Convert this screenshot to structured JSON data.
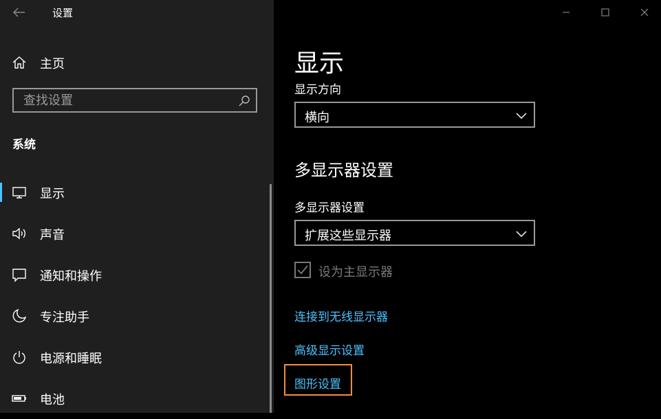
{
  "window": {
    "title": "设置",
    "controls": [
      "minimize",
      "maximize",
      "close"
    ]
  },
  "sidebar": {
    "home_label": "主页",
    "search": {
      "placeholder": "查找设置",
      "value": ""
    },
    "section_label": "系统",
    "items": [
      {
        "label": "显示",
        "icon": "monitor-icon",
        "active": true
      },
      {
        "label": "声音",
        "icon": "speaker-icon",
        "active": false
      },
      {
        "label": "通知和操作",
        "icon": "notification-icon",
        "active": false
      },
      {
        "label": "专注助手",
        "icon": "moon-icon",
        "active": false
      },
      {
        "label": "电源和睡眠",
        "icon": "power-icon",
        "active": false
      },
      {
        "label": "电池",
        "icon": "battery-icon",
        "active": false
      }
    ]
  },
  "main": {
    "title": "显示",
    "orientation": {
      "label": "显示方向",
      "value": "横向"
    },
    "multi_display": {
      "heading": "多显示器设置",
      "label": "多显示器设置",
      "value": "扩展这些显示器"
    },
    "primary_checkbox": {
      "label": "设为主显示器",
      "checked": true,
      "disabled": true
    },
    "links": {
      "wireless": "连接到无线显示器",
      "advanced": "高级显示设置",
      "graphics": "图形设置"
    }
  },
  "colors": {
    "sidebar_bg": "#1f1f1f",
    "main_bg": "#000000",
    "accent": "#4cc2ff",
    "highlight": "#f58e3c",
    "disabled": "#7a7a7a"
  }
}
